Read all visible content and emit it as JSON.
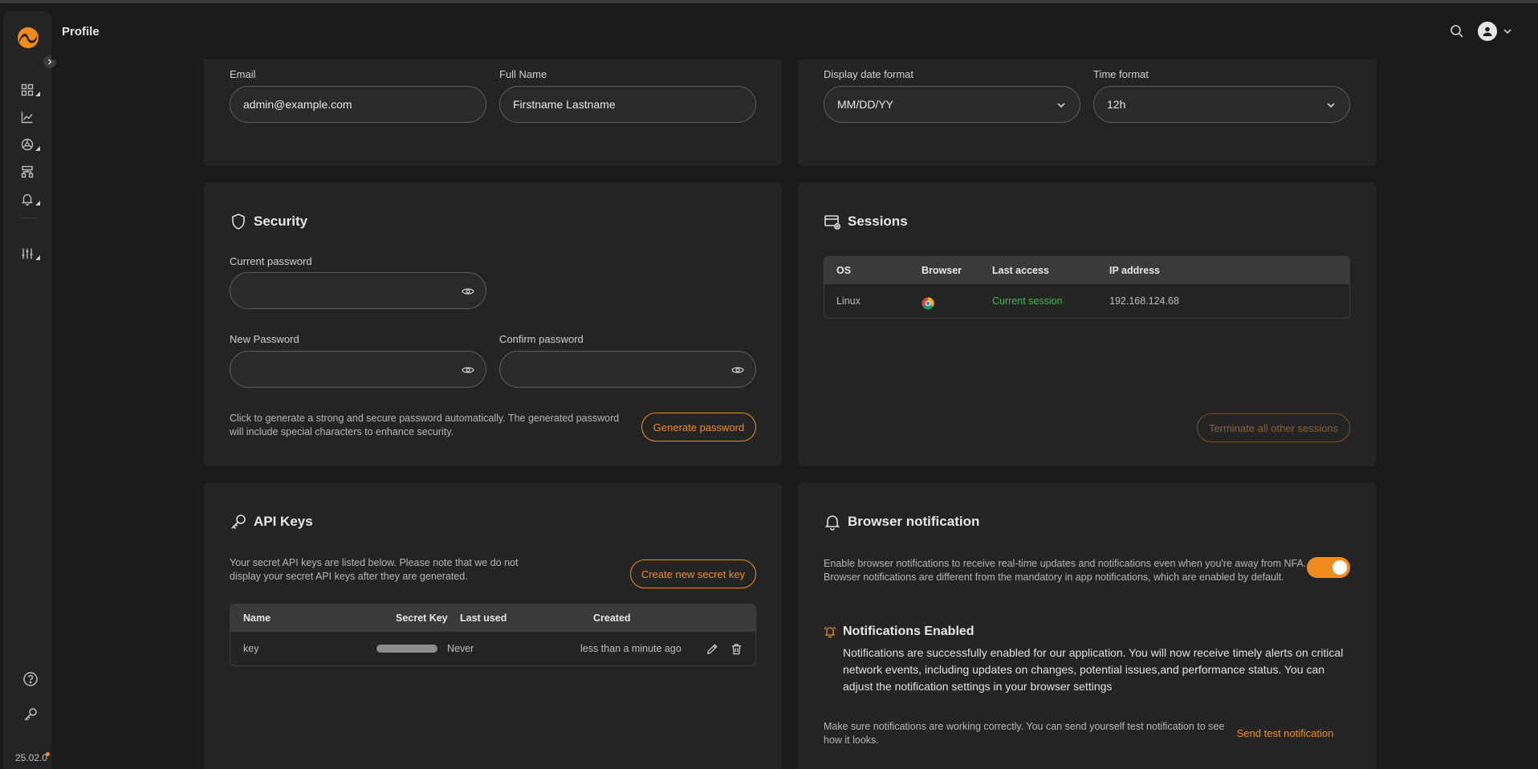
{
  "header": {
    "title": "Profile"
  },
  "sidebar": {
    "items": [
      {
        "icon": "dashboard-icon",
        "submenu": true
      },
      {
        "icon": "chart-line-icon",
        "submenu": false
      },
      {
        "icon": "network-icon",
        "submenu": true
      },
      {
        "icon": "topology-icon",
        "submenu": false
      },
      {
        "icon": "bell-icon",
        "submenu": true
      },
      {
        "icon": "sliders-icon",
        "submenu": true
      }
    ],
    "version": "25.02.0"
  },
  "account": {
    "email_label": "Email",
    "email_value": "admin@example.com",
    "fullname_label": "Full Name",
    "fullname_value": "Firstname Lastname"
  },
  "preferences": {
    "date_label": "Display date format",
    "date_value": "MM/DD/YY",
    "time_label": "Time format",
    "time_value": "12h"
  },
  "security": {
    "title": "Security",
    "current_label": "Current password",
    "new_label": "New Password",
    "confirm_label": "Confirm password",
    "help": "Click to generate a strong and secure password automatically. The generated password will include special characters to enhance security.",
    "generate_label": "Generate password"
  },
  "sessions": {
    "title": "Sessions",
    "columns": [
      "OS",
      "Browser",
      "Last access",
      "IP address"
    ],
    "rows": [
      {
        "os": "Linux",
        "browser": "chrome-icon",
        "last_access": "Current session",
        "ip": "192.168.124.68"
      }
    ],
    "terminate_label": "Terminate all other sessions"
  },
  "api_keys": {
    "title": "API Keys",
    "help": "Your secret API keys are listed below. Please note that we do not display your secret API keys after they are generated.",
    "create_label": "Create new secret key",
    "columns": [
      "Name",
      "Secret Key",
      "Last used",
      "Created"
    ],
    "rows": [
      {
        "name": "key",
        "last_used": "Never",
        "created": "less than a minute ago"
      }
    ]
  },
  "notifications": {
    "title": "Browser notification",
    "description": "Enable browser notifications to receive real-time updates and notifications even when you're away from NFA. Browser notifications are different from the mandatory in app notifications, which are enabled by default.",
    "enabled": true,
    "status_title": "Notifications Enabled",
    "status_text": "Notifications are successfully enabled for our application. You will now receive timely alerts on critical network events, including updates on changes, potential issues,and performance status. You can adjust the notification settings in your browser settings",
    "test_help": "Make sure notifications are working correctly. You can send yourself test notification to see how it looks.",
    "test_label": "Send test notification"
  },
  "colors": {
    "accent": "#f28b1e",
    "success": "#3fb950",
    "card": "#242424",
    "background": "#1a1a1a"
  }
}
